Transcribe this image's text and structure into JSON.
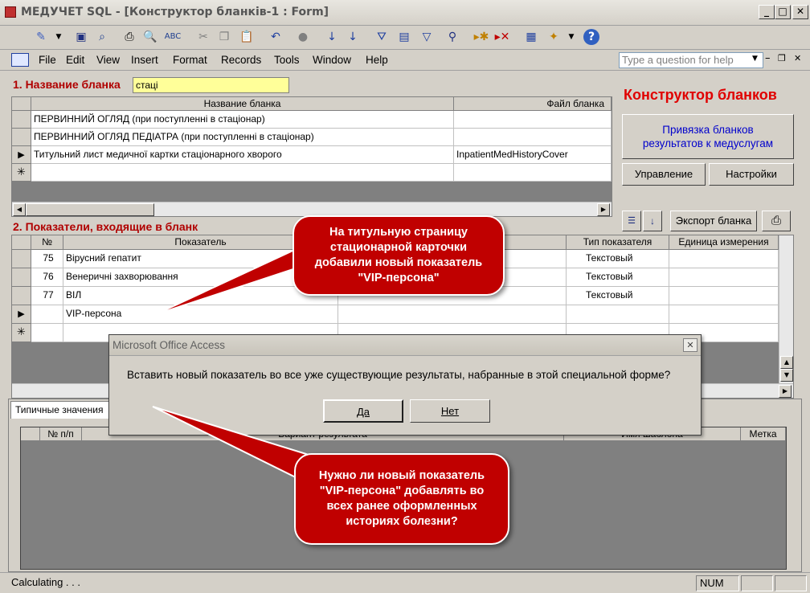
{
  "window": {
    "title": "МЕДУЧЕТ SQL - [Конструктор бланків-1 : Form]"
  },
  "menubar": {
    "items": [
      "File",
      "Edit",
      "View",
      "Insert",
      "Format",
      "Records",
      "Tools",
      "Window",
      "Help"
    ],
    "ask_placeholder": "Type a question for help"
  },
  "section1": {
    "label": "1. Название бланка",
    "filter_value": "стаці",
    "columns": [
      "Название бланка",
      "Файл бланка"
    ],
    "rows": [
      {
        "name": "ПЕРВИННИЙ ОГЛЯД (при поступленні в стаціонар)",
        "file": ""
      },
      {
        "name": "ПЕРВИННИЙ ОГЛЯД ПЕДІАТРА (при поступленні в стаціонар)",
        "file": ""
      },
      {
        "name": "Титульний лист медичної картки стаціонарного хворого",
        "file": "InpatientMedHistoryCover"
      }
    ]
  },
  "right_panel": {
    "title": "Конструктор бланков",
    "link_button": "Привязка бланков результатов к медуслугам",
    "manage_button": "Управление",
    "settings_button": "Настройки",
    "export_button": "Экспорт бланка"
  },
  "section2": {
    "label": "2. Показатели, входящие в бланк",
    "columns": [
      "№",
      "Показатель",
      "Тип показателя",
      "Единица измерения"
    ],
    "rows": [
      {
        "num": "75",
        "name": "Вірусний гепатит",
        "type": "Текстовый"
      },
      {
        "num": "76",
        "name": "Венеричні захворювання",
        "type": "Текстовый"
      },
      {
        "num": "77",
        "name": "ВІЛ",
        "type": "Текстовый"
      },
      {
        "num": "",
        "name": "VIP-персона",
        "type": ""
      }
    ]
  },
  "section3": {
    "tab": "Типичные значения",
    "columns": [
      "№ п/п",
      "Вариант результата",
      "Имя шаблона",
      "Метка"
    ]
  },
  "dialog": {
    "title": "Microsoft Office Access",
    "message": "Вставить новый показатель во все уже существующие результаты, набранные в этой специальной форме?",
    "yes": "Да",
    "no": "Нет"
  },
  "callout1": {
    "text": "На титульную страницу стационарной карточки добавили новый показатель \"VIP-персона\""
  },
  "callout2": {
    "text": "Нужно ли новый показатель \"VIP-персона\" добавлять во всех ранее оформленных историях болезни?"
  },
  "statusbar": {
    "left": "Calculating . . .",
    "num": "NUM"
  },
  "colors": {
    "section_label": "#b00000",
    "callout": "#c00000",
    "filter_bg": "#ffff99",
    "title_red": "#e00000",
    "link_blue": "#0000cc"
  }
}
